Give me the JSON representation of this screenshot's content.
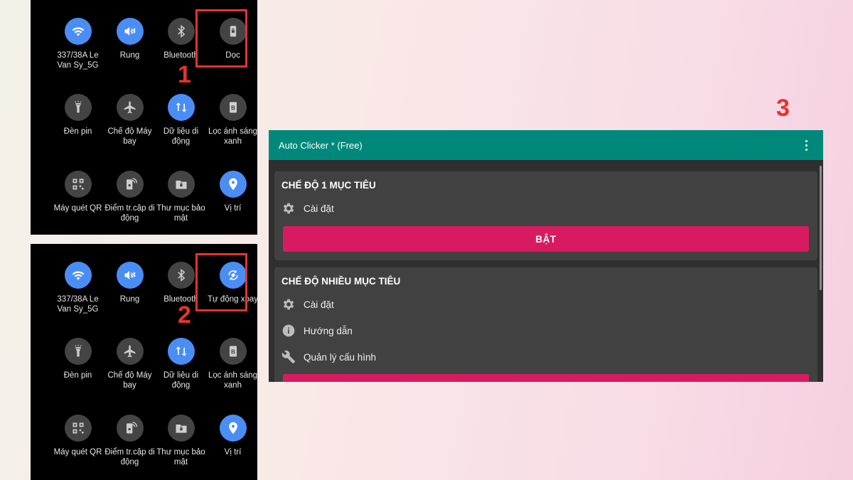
{
  "panel1": {
    "tiles": [
      {
        "label": "337/38A Le Van Sy_5G",
        "icon": "wifi-icon",
        "state": "on"
      },
      {
        "label": "Rung",
        "icon": "vibrate-icon",
        "state": "on"
      },
      {
        "label": "Bluetooth",
        "icon": "bluetooth-icon",
        "state": "off"
      },
      {
        "label": "Dọc",
        "icon": "portrait-lock-icon",
        "state": "off"
      },
      {
        "label": "Đèn pin",
        "icon": "flashlight-icon",
        "state": "off"
      },
      {
        "label": "Chế độ Máy bay",
        "icon": "airplane-icon",
        "state": "off"
      },
      {
        "label": "Dữ liệu di động",
        "icon": "mobile-data-icon",
        "state": "on"
      },
      {
        "label": "Lọc ánh sáng xanh",
        "icon": "blue-light-filter-icon",
        "state": "off"
      },
      {
        "label": "Máy quét QR",
        "icon": "qr-scanner-icon",
        "state": "off"
      },
      {
        "label": "Điểm tr.cập di động",
        "icon": "hotspot-icon",
        "state": "off"
      },
      {
        "label": "Thư mục bảo mật",
        "icon": "secure-folder-icon",
        "state": "off"
      },
      {
        "label": "Vị trí",
        "icon": "location-icon",
        "state": "on"
      }
    ],
    "step": "1"
  },
  "panel2": {
    "tiles": [
      {
        "label": "337/38A Le Van Sy_5G",
        "icon": "wifi-icon",
        "state": "on"
      },
      {
        "label": "Rung",
        "icon": "vibrate-icon",
        "state": "on"
      },
      {
        "label": "Bluetooth",
        "icon": "bluetooth-icon",
        "state": "off"
      },
      {
        "label": "Tự động xoay",
        "icon": "auto-rotate-icon",
        "state": "on"
      },
      {
        "label": "Đèn pin",
        "icon": "flashlight-icon",
        "state": "off"
      },
      {
        "label": "Chế độ Máy bay",
        "icon": "airplane-icon",
        "state": "off"
      },
      {
        "label": "Dữ liệu di động",
        "icon": "mobile-data-icon",
        "state": "on"
      },
      {
        "label": "Lọc ánh sáng xanh",
        "icon": "blue-light-filter-icon",
        "state": "off"
      },
      {
        "label": "Máy quét QR",
        "icon": "qr-scanner-icon",
        "state": "off"
      },
      {
        "label": "Điểm tr.cập di động",
        "icon": "hotspot-icon",
        "state": "off"
      },
      {
        "label": "Thư mục bảo mật",
        "icon": "secure-folder-icon",
        "state": "off"
      },
      {
        "label": "Vị trí",
        "icon": "location-icon",
        "state": "on"
      }
    ],
    "step": "2"
  },
  "app": {
    "step": "3",
    "title": "Auto Clicker * (Free)",
    "menu_icon": "more-vert-icon",
    "single_mode": {
      "title": "CHẾ ĐỘ 1 MỤC TIÊU",
      "settings": "Cài đặt",
      "button": "BẬT"
    },
    "multi_mode": {
      "title": "CHẾ ĐỘ NHIỀU MỤC TIÊU",
      "settings": "Cài đặt",
      "guide": "Hướng dẫn",
      "config": "Quản lý cấu hình"
    }
  },
  "colors": {
    "tile_on": "#4a8ef5",
    "tile_off": "#444444",
    "highlight": "#e4342f",
    "appbar": "#00897b",
    "button": "#d81b60"
  }
}
